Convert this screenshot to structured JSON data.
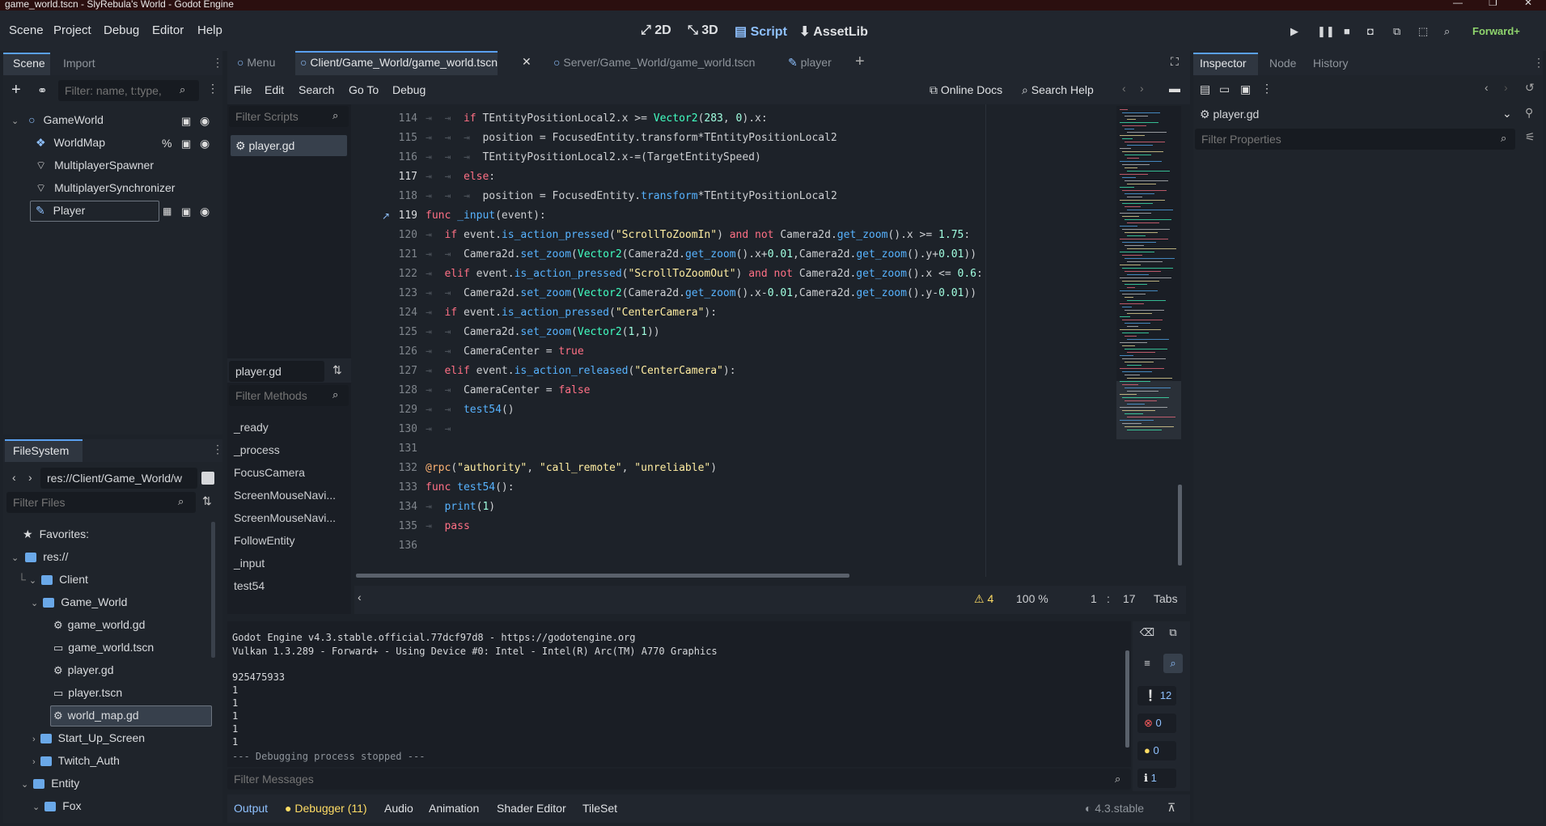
{
  "window": {
    "title": "game_world.tscn - SlyRebula's World - Godot Engine"
  },
  "menu": [
    "Scene",
    "Project",
    "Debug",
    "Editor",
    "Help"
  ],
  "workspaces": [
    {
      "label": "2D",
      "icon": "2d-icon"
    },
    {
      "label": "3D",
      "icon": "3d-icon"
    },
    {
      "label": "Script",
      "icon": "script-icon"
    },
    {
      "label": "AssetLib",
      "icon": "assetlib-icon"
    }
  ],
  "renderer": "Forward+",
  "scene_dock": {
    "tabs": [
      "Scene",
      "Import"
    ],
    "filter_placeholder": "Filter: name, t:type,",
    "nodes": [
      {
        "label": "GameWorld"
      },
      {
        "label": "WorldMap"
      },
      {
        "label": "MultiplayerSpawner"
      },
      {
        "label": "MultiplayerSynchronizer"
      },
      {
        "label": "Player"
      }
    ]
  },
  "filesystem": {
    "tab": "FileSystem",
    "path": "res://Client/Game_World/w",
    "filter_placeholder": "Filter Files",
    "items": [
      {
        "label": "Favorites:"
      },
      {
        "label": "res://"
      },
      {
        "label": "Client"
      },
      {
        "label": "Game_World"
      },
      {
        "label": "game_world.gd"
      },
      {
        "label": "game_world.tscn"
      },
      {
        "label": "player.gd"
      },
      {
        "label": "player.tscn"
      },
      {
        "label": "world_map.gd"
      },
      {
        "label": "Start_Up_Screen"
      },
      {
        "label": "Twitch_Auth"
      },
      {
        "label": "Entity"
      },
      {
        "label": "Fox"
      }
    ]
  },
  "editor_tabs": [
    "Menu",
    "Client/Game_World/game_world.tscn",
    "Server/Game_World/game_world.tscn",
    "player"
  ],
  "script_menu": [
    "File",
    "Edit",
    "Search",
    "Go To",
    "Debug"
  ],
  "online_docs": "Online Docs",
  "search_help": "Search Help",
  "scripts": {
    "filter_placeholder": "Filter Scripts",
    "open": [
      "player.gd"
    ],
    "current": "player.gd",
    "methods_placeholder": "Filter Methods",
    "methods": [
      "_ready",
      "_process",
      "FocusCamera",
      "ScreenMouseNavi...",
      "ScreenMouseNavi...",
      "FollowEntity",
      "_input",
      "test54"
    ]
  },
  "code_lines": [
    "114",
    "115",
    "116",
    "117",
    "118",
    "119",
    "120",
    "121",
    "122",
    "123",
    "124",
    "125",
    "126",
    "127",
    "128",
    "129",
    "130",
    "131",
    "132",
    "133",
    "134",
    "135",
    "136"
  ],
  "status": {
    "warnings": "4",
    "zoom": "100 %",
    "line": "1",
    "col": "17",
    "indent": "Tabs"
  },
  "output": {
    "lines": [
      "Godot Engine v4.3.stable.official.77dcf97d8 - https://godotengine.org",
      "Vulkan 1.3.289 - Forward+ - Using Device #0: Intel - Intel(R) Arc(TM) A770 Graphics",
      "",
      "925475933",
      "1",
      "1",
      "1",
      "1",
      "1",
      "--- Debugging process stopped ---"
    ],
    "filter_placeholder": "Filter Messages",
    "counts": {
      "messages": "12",
      "errors": "0",
      "warnings": "0",
      "info": "1"
    }
  },
  "bottom_tabs": [
    "Output",
    "Debugger (11)",
    "Audio",
    "Animation",
    "Shader Editor",
    "TileSet"
  ],
  "version": "4.3.stable",
  "inspector": {
    "tabs": [
      "Inspector",
      "Node",
      "History"
    ],
    "object": "player.gd",
    "filter_placeholder": "Filter Properties"
  }
}
